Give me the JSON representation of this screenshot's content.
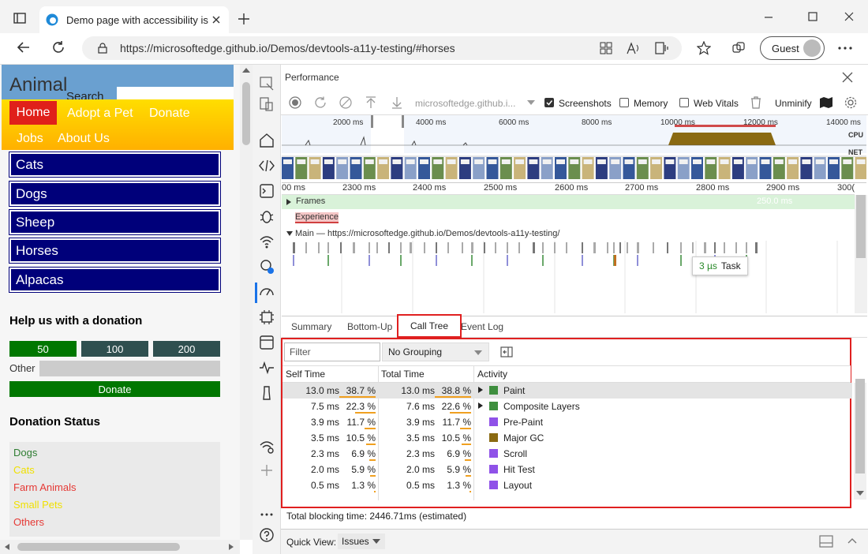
{
  "browser": {
    "tab_title": "Demo page with accessibility issu",
    "url": "https://microsoftedge.github.io/Demos/devtools-a11y-testing/#horses",
    "profile_label": "Guest"
  },
  "page": {
    "logo_text": "Animal",
    "search_label": "Search",
    "nav": [
      "Home",
      "Adopt a Pet",
      "Donate",
      "Jobs",
      "About Us"
    ],
    "animals": [
      "Cats",
      "Dogs",
      "Sheep",
      "Horses",
      "Alpacas"
    ],
    "donation_heading": "Help us with a donation",
    "amounts": [
      "50",
      "100",
      "200"
    ],
    "other_label": "Other",
    "donate_button": "Donate",
    "status_heading": "Donation Status",
    "status_items": [
      {
        "label": "Dogs",
        "color": "#2e7d32"
      },
      {
        "label": "Cats",
        "color": "#f0e000"
      },
      {
        "label": "Farm Animals",
        "color": "#e53935"
      },
      {
        "label": "Small Pets",
        "color": "#f0e000"
      },
      {
        "label": "Others",
        "color": "#e53935"
      }
    ]
  },
  "devtools": {
    "panel_title": "Performance",
    "toolbar": {
      "recording_select": "microsoftedge.github.i...",
      "screenshots_label": "Screenshots",
      "screenshots_checked": true,
      "memory_label": "Memory",
      "memory_checked": false,
      "web_vitals_label": "Web Vitals",
      "web_vitals_checked": false,
      "unminify_label": "Unminify"
    },
    "overview_ticks": [
      "2000 ms",
      "4000 ms",
      "6000 ms",
      "8000 ms",
      "10000 ms",
      "12000 ms",
      "14000 ms"
    ],
    "overview_labels": {
      "cpu": "CPU",
      "net": "NET"
    },
    "ruler_ticks": [
      "00 ms",
      "2300 ms",
      "2400 ms",
      "2500 ms",
      "2600 ms",
      "2700 ms",
      "2800 ms",
      "2900 ms",
      "300("
    ],
    "tracks": {
      "frames_label": "Frames",
      "frames_value": "250.0 ms",
      "experience_label": "Experience",
      "main_label": "Main — https://microsoftedge.github.io/Demos/devtools-a11y-testing/"
    },
    "tooltip": {
      "time": "3 µs",
      "label": "Task"
    },
    "tabs": [
      "Summary",
      "Bottom-Up",
      "Call Tree",
      "Event Log"
    ],
    "active_tab": "Call Tree",
    "filter_placeholder": "Filter",
    "grouping": "No Grouping",
    "columns": [
      "Self Time",
      "Total Time",
      "Activity"
    ],
    "rows": [
      {
        "self_ms": "13.0 ms",
        "self_pct": "38.7 %",
        "total_ms": "13.0 ms",
        "total_pct": "38.8 %",
        "activity": "Paint",
        "color": "#3f8f3f",
        "expandable": true,
        "selected": true,
        "self_frac": 0.387,
        "total_frac": 0.388
      },
      {
        "self_ms": "7.5 ms",
        "self_pct": "22.3 %",
        "total_ms": "7.6 ms",
        "total_pct": "22.6 %",
        "activity": "Composite Layers",
        "color": "#3f8f3f",
        "expandable": true,
        "selected": false,
        "self_frac": 0.223,
        "total_frac": 0.226
      },
      {
        "self_ms": "3.9 ms",
        "self_pct": "11.7 %",
        "total_ms": "3.9 ms",
        "total_pct": "11.7 %",
        "activity": "Pre-Paint",
        "color": "#8f52e8",
        "expandable": false,
        "selected": false,
        "self_frac": 0.117,
        "total_frac": 0.117
      },
      {
        "self_ms": "3.5 ms",
        "self_pct": "10.5 %",
        "total_ms": "3.5 ms",
        "total_pct": "10.5 %",
        "activity": "Major GC",
        "color": "#8a6a12",
        "expandable": false,
        "selected": false,
        "self_frac": 0.105,
        "total_frac": 0.105
      },
      {
        "self_ms": "2.3 ms",
        "self_pct": "6.9 %",
        "total_ms": "2.3 ms",
        "total_pct": "6.9 %",
        "activity": "Scroll",
        "color": "#8f52e8",
        "expandable": false,
        "selected": false,
        "self_frac": 0.069,
        "total_frac": 0.069
      },
      {
        "self_ms": "2.0 ms",
        "self_pct": "5.9 %",
        "total_ms": "2.0 ms",
        "total_pct": "5.9 %",
        "activity": "Hit Test",
        "color": "#8f52e8",
        "expandable": false,
        "selected": false,
        "self_frac": 0.059,
        "total_frac": 0.059
      },
      {
        "self_ms": "0.5 ms",
        "self_pct": "1.3 %",
        "total_ms": "0.5 ms",
        "total_pct": "1.3 %",
        "activity": "Layout",
        "color": "#8f52e8",
        "expandable": false,
        "selected": false,
        "self_frac": 0.013,
        "total_frac": 0.013
      }
    ],
    "total_blocking_time": "Total blocking time: 2446.71ms (estimated)",
    "drawer": {
      "label": "Quick View:",
      "selected": "Issues"
    }
  }
}
